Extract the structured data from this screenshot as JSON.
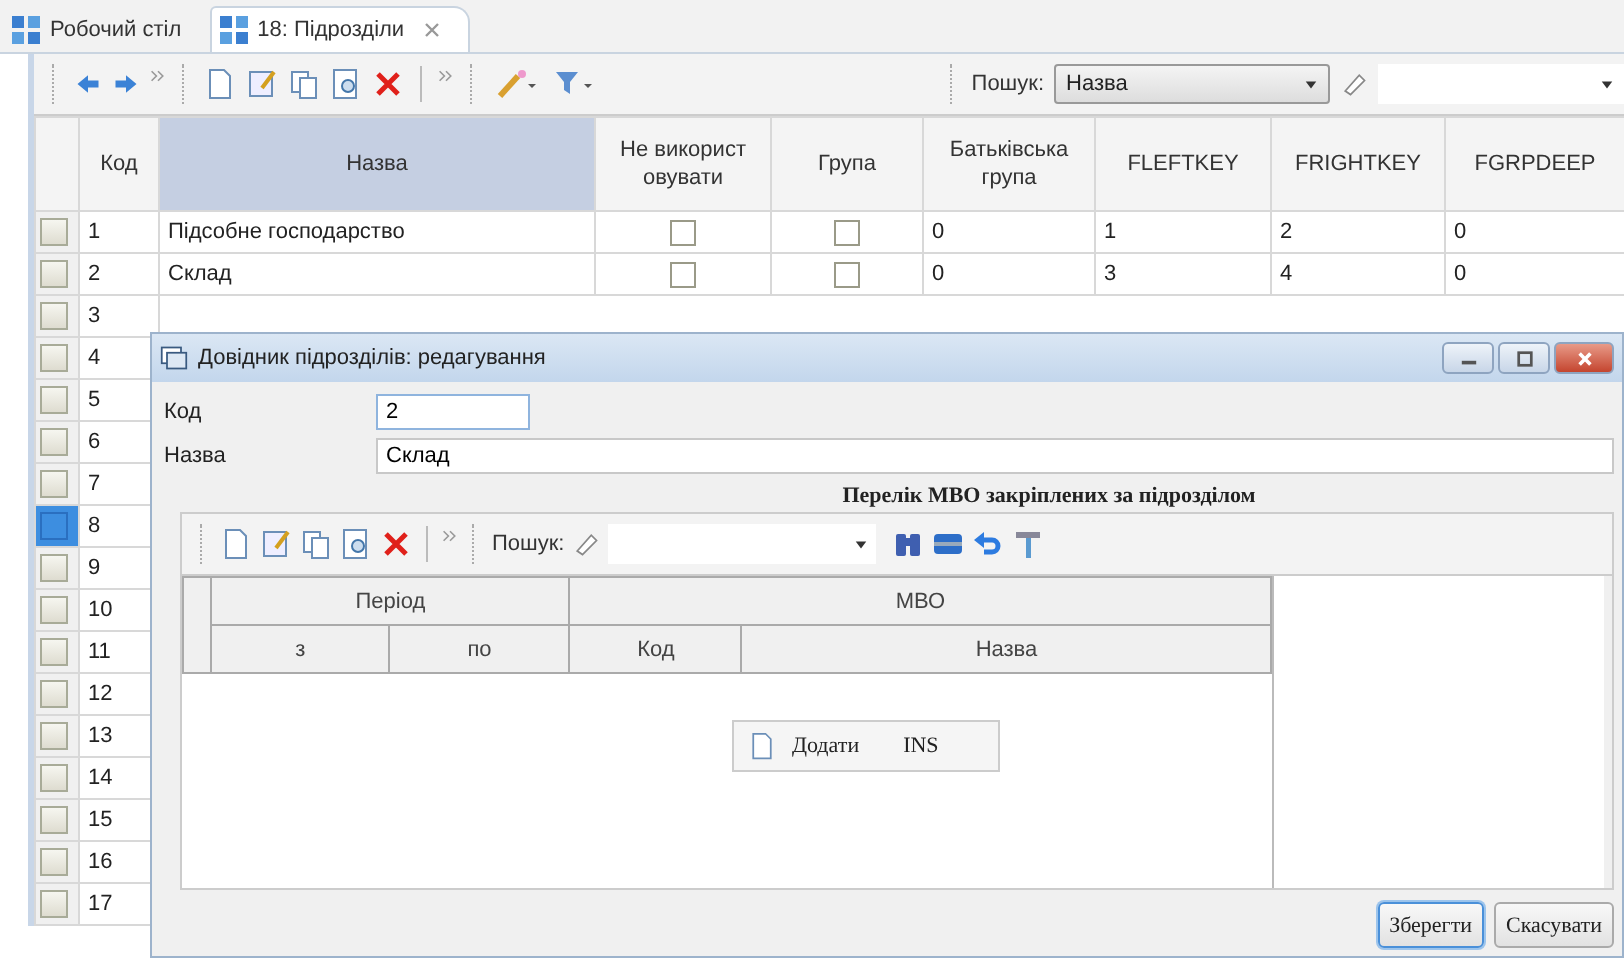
{
  "tabs": [
    {
      "label": "Робочий стіл",
      "selected": false
    },
    {
      "label": "18: Підрозділи",
      "selected": true
    }
  ],
  "search": {
    "label": "Пошук:",
    "field": "Назва"
  },
  "table": {
    "columns": [
      "Код",
      "Назва",
      "Не використ овувати",
      "Група",
      "Батьківська група",
      "FLEFTKEY",
      "FRIGHTKEY",
      "FGRPDEEP"
    ],
    "rows": [
      {
        "code": "1",
        "name": "Підсобне господарство",
        "unused": false,
        "group": false,
        "parent": "0",
        "fleftkey": "1",
        "frightkey": "2",
        "fgrpdeep": "0",
        "selected": false
      },
      {
        "code": "2",
        "name": "Склад",
        "unused": false,
        "group": false,
        "parent": "0",
        "fleftkey": "3",
        "frightkey": "4",
        "fgrpdeep": "0",
        "selected": false
      },
      {
        "code": "3",
        "selected": false
      },
      {
        "code": "4",
        "selected": false
      },
      {
        "code": "5",
        "selected": false
      },
      {
        "code": "6",
        "selected": false
      },
      {
        "code": "7",
        "selected": false
      },
      {
        "code": "8",
        "selected": true
      },
      {
        "code": "9",
        "selected": false
      },
      {
        "code": "10",
        "selected": false
      },
      {
        "code": "11",
        "selected": false
      },
      {
        "code": "12",
        "selected": false
      },
      {
        "code": "13",
        "selected": false
      },
      {
        "code": "14",
        "selected": false
      },
      {
        "code": "15",
        "selected": false
      },
      {
        "code": "16",
        "selected": false
      },
      {
        "code": "17",
        "selected": false
      }
    ]
  },
  "dialog": {
    "title": "Довідник підрозділів: редагування",
    "fields": [
      {
        "label": "Код",
        "value": "2",
        "kind": "short"
      },
      {
        "label": "Назва",
        "value": "Склад",
        "kind": "wide"
      }
    ],
    "section_title": "Перелік МВО закріплених за підрозділом",
    "search_label": "Пошук:",
    "group_headers": [
      "Період",
      "МВО"
    ],
    "columns": [
      "з",
      "по",
      "Код",
      "Назва"
    ],
    "context_menu": [
      {
        "label": "Додати",
        "shortcut": "INS"
      }
    ],
    "buttons": [
      {
        "label": "Зберегти",
        "default": true
      },
      {
        "label": "Скасувати",
        "default": false
      }
    ]
  }
}
